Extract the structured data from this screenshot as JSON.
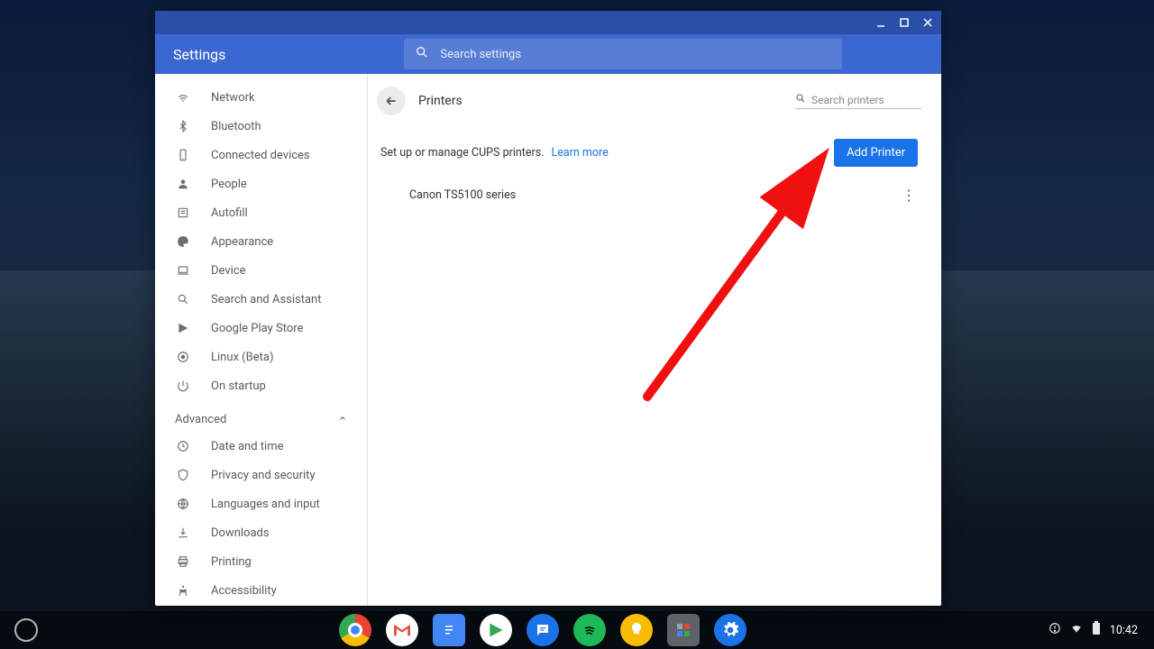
{
  "header": {
    "title": "Settings",
    "search_placeholder": "Search settings"
  },
  "sidebar": {
    "items": [
      {
        "label": "Network"
      },
      {
        "label": "Bluetooth"
      },
      {
        "label": "Connected devices"
      },
      {
        "label": "People"
      },
      {
        "label": "Autofill"
      },
      {
        "label": "Appearance"
      },
      {
        "label": "Device"
      },
      {
        "label": "Search and Assistant"
      },
      {
        "label": "Google Play Store"
      },
      {
        "label": "Linux (Beta)"
      },
      {
        "label": "On startup"
      }
    ],
    "advanced_label": "Advanced",
    "advanced_items": [
      {
        "label": "Date and time"
      },
      {
        "label": "Privacy and security"
      },
      {
        "label": "Languages and input"
      },
      {
        "label": "Downloads"
      },
      {
        "label": "Printing"
      },
      {
        "label": "Accessibility"
      }
    ]
  },
  "page": {
    "title": "Printers",
    "search_placeholder": "Search printers",
    "setup_text": "Set up or manage CUPS printers.",
    "learn_more": "Learn more",
    "add_button": "Add Printer",
    "printers": [
      {
        "name": "Canon TS5100 series"
      }
    ]
  },
  "status": {
    "time": "10:42"
  }
}
